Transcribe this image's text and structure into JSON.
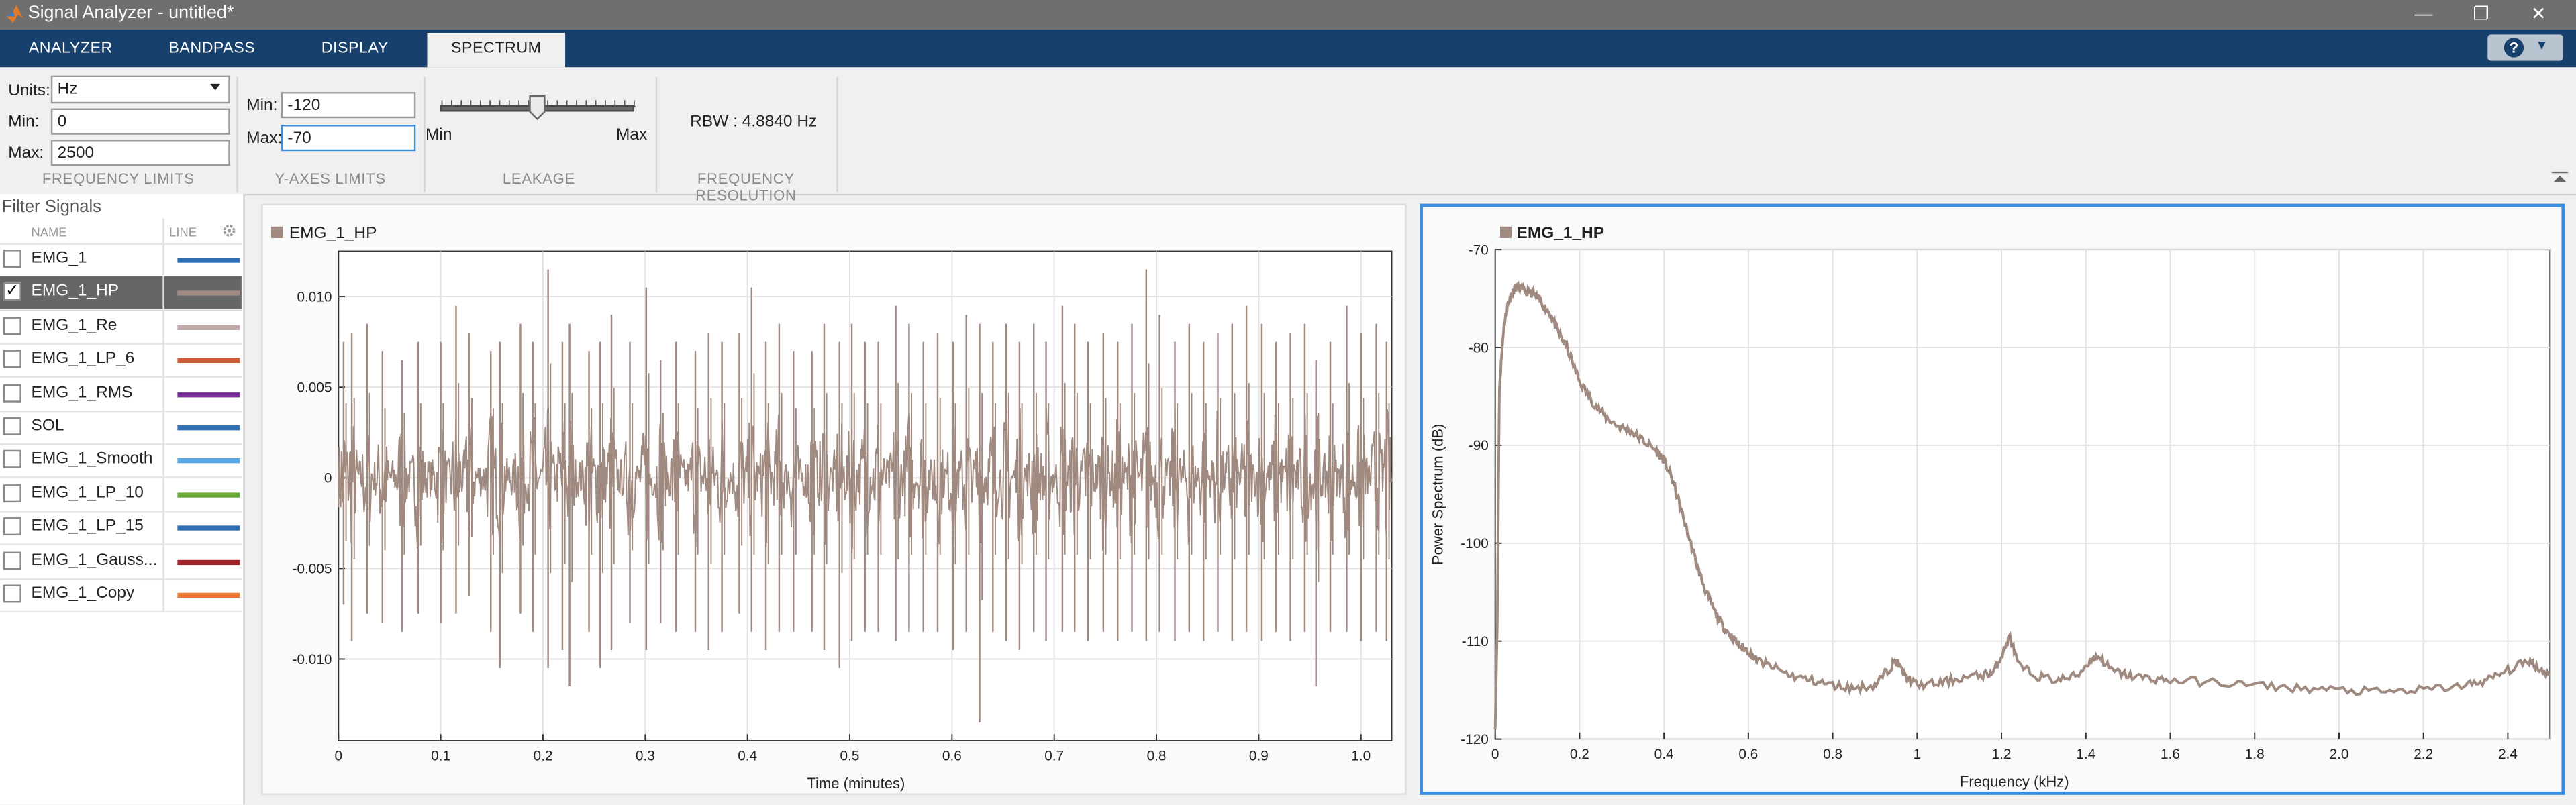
{
  "window": {
    "title": "Signal Analyzer - untitled*",
    "controls": [
      "—",
      "❐",
      "✕"
    ]
  },
  "tabs": [
    {
      "label": "ANALYZER",
      "active": false
    },
    {
      "label": "BANDPASS",
      "active": false
    },
    {
      "label": "DISPLAY",
      "active": false
    },
    {
      "label": "SPECTRUM",
      "active": true
    }
  ],
  "help": {
    "icon": "help-icon",
    "dropdown": "▼"
  },
  "frequency_limits": {
    "units_label": "Units:",
    "units_value": "Hz",
    "min_label": "Min:",
    "min_value": "0",
    "max_label": "Max:",
    "max_value": "2500",
    "section_title": "FREQUENCY LIMITS"
  },
  "y_axes_limits": {
    "min_label": "Min:",
    "min_value": "-120",
    "max_label": "Max:",
    "max_value": "-70",
    "section_title": "Y-AXES LIMITS"
  },
  "leakage": {
    "min_label": "Min",
    "max_label": "Max",
    "value": 0.5,
    "section_title": "LEAKAGE"
  },
  "frequency_resolution": {
    "rbw_text": "RBW : 4.8840 Hz",
    "section_title": "FREQUENCY RESOLUTION"
  },
  "filter_panel": {
    "title": "Filter Signals",
    "col_name": "NAME",
    "col_line": "LINE",
    "signals": [
      {
        "name": "EMG_1",
        "checked": false,
        "color": "#2f6fb5"
      },
      {
        "name": "EMG_1_HP",
        "checked": true,
        "color": "#a08a80",
        "selected": true
      },
      {
        "name": "EMG_1_Re",
        "checked": false,
        "color": "#c0aaa8"
      },
      {
        "name": "EMG_1_LP_6",
        "checked": false,
        "color": "#cf5a35"
      },
      {
        "name": "EMG_1_RMS",
        "checked": false,
        "color": "#7b2f9c"
      },
      {
        "name": "SOL",
        "checked": false,
        "color": "#2f6fb5"
      },
      {
        "name": "EMG_1_Smooth",
        "checked": false,
        "color": "#55a7e6"
      },
      {
        "name": "EMG_1_LP_10",
        "checked": false,
        "color": "#6aaa3a"
      },
      {
        "name": "EMG_1_LP_15",
        "checked": false,
        "color": "#2f6fb5"
      },
      {
        "name": "EMG_1_Gauss...",
        "checked": false,
        "color": "#a2232c"
      },
      {
        "name": "EMG_1_Copy",
        "checked": false,
        "color": "#e9772f"
      }
    ]
  },
  "colors": {
    "signal": "#a08a80",
    "accent": "#3b8ede",
    "tabbar": "#17406c"
  },
  "chart_data": [
    {
      "type": "line",
      "legend": "EMG_1_HP",
      "xlabel": "Time (minutes)",
      "ylabel": "",
      "xlim": [
        0,
        1.03
      ],
      "ylim": [
        -0.0145,
        0.0125
      ],
      "xticks": [
        "0",
        "0.1",
        "0.2",
        "0.3",
        "0.4",
        "0.5",
        "0.6",
        "0.7",
        "0.8",
        "0.9",
        "1.0"
      ],
      "xtick_values": [
        0,
        0.1,
        0.2,
        0.3,
        0.4,
        0.5,
        0.6,
        0.7,
        0.8,
        0.9,
        1.0
      ],
      "yticks": [
        "0.010",
        "0.005",
        "0",
        "-0.005",
        "-0.010"
      ],
      "ytick_values": [
        0.01,
        0.005,
        0,
        -0.005,
        -0.01
      ],
      "series": [
        {
          "name": "EMG_1_HP",
          "bursts": [
            [
              0.005,
              0.0075,
              -0.007
            ],
            [
              0.013,
              0.008,
              -0.009
            ],
            [
              0.028,
              0.0085,
              -0.0075
            ],
            [
              0.043,
              0.007,
              -0.008
            ],
            [
              0.062,
              0.0065,
              -0.0085
            ],
            [
              0.078,
              0.0075,
              -0.0075
            ],
            [
              0.1,
              0.0075,
              -0.008
            ],
            [
              0.115,
              0.0095,
              -0.0075
            ],
            [
              0.128,
              0.008,
              -0.0065
            ],
            [
              0.149,
              0.007,
              -0.0085
            ],
            [
              0.158,
              0.0075,
              -0.0105
            ],
            [
              0.178,
              0.0085,
              -0.0075
            ],
            [
              0.19,
              0.0075,
              -0.0085
            ],
            [
              0.205,
              0.0115,
              -0.0105
            ],
            [
              0.219,
              0.0075,
              -0.0095
            ],
            [
              0.226,
              0.0085,
              -0.0115
            ],
            [
              0.245,
              0.007,
              -0.0085
            ],
            [
              0.256,
              0.0075,
              -0.0105
            ],
            [
              0.267,
              0.009,
              -0.0095
            ],
            [
              0.285,
              0.0075,
              -0.008
            ],
            [
              0.301,
              0.0105,
              -0.0095
            ],
            [
              0.315,
              0.0065,
              -0.008
            ],
            [
              0.33,
              0.0075,
              -0.0085
            ],
            [
              0.349,
              0.007,
              -0.0085
            ],
            [
              0.362,
              0.008,
              -0.0095
            ],
            [
              0.375,
              0.0075,
              -0.0085
            ],
            [
              0.392,
              0.008,
              -0.0075
            ],
            [
              0.404,
              0.0105,
              -0.0085
            ],
            [
              0.418,
              0.0075,
              -0.0095
            ],
            [
              0.431,
              0.0085,
              -0.0085
            ],
            [
              0.445,
              0.007,
              -0.0085
            ],
            [
              0.463,
              0.007,
              -0.0085
            ],
            [
              0.475,
              0.0085,
              -0.0095
            ],
            [
              0.49,
              0.0075,
              -0.0105
            ],
            [
              0.502,
              0.0085,
              -0.009
            ],
            [
              0.515,
              0.0075,
              -0.0085
            ],
            [
              0.528,
              0.0075,
              -0.0085
            ],
            [
              0.545,
              0.0095,
              -0.009
            ],
            [
              0.558,
              0.0085,
              -0.0085
            ],
            [
              0.572,
              0.0075,
              -0.0085
            ],
            [
              0.586,
              0.008,
              -0.0085
            ],
            [
              0.601,
              0.0075,
              -0.0095
            ],
            [
              0.614,
              0.009,
              -0.0085
            ],
            [
              0.627,
              0.0085,
              -0.0135
            ],
            [
              0.64,
              0.0075,
              -0.0085
            ],
            [
              0.653,
              0.0085,
              -0.009
            ],
            [
              0.666,
              0.0075,
              -0.0095
            ],
            [
              0.68,
              0.0085,
              -0.0085
            ],
            [
              0.692,
              0.0075,
              -0.009
            ],
            [
              0.708,
              0.0095,
              -0.0085
            ],
            [
              0.72,
              0.0085,
              -0.0085
            ],
            [
              0.733,
              0.0075,
              -0.009
            ],
            [
              0.748,
              0.008,
              -0.0085
            ],
            [
              0.762,
              0.0075,
              -0.009
            ],
            [
              0.776,
              0.0085,
              -0.0085
            ],
            [
              0.79,
              0.0115,
              -0.009
            ],
            [
              0.803,
              0.009,
              -0.0085
            ],
            [
              0.818,
              0.0075,
              -0.009
            ],
            [
              0.832,
              0.0085,
              -0.0085
            ],
            [
              0.846,
              0.0075,
              -0.009
            ],
            [
              0.86,
              0.008,
              -0.0085
            ],
            [
              0.874,
              0.0085,
              -0.009
            ],
            [
              0.888,
              0.0095,
              -0.0085
            ],
            [
              0.903,
              0.0085,
              -0.009
            ],
            [
              0.917,
              0.0075,
              -0.0085
            ],
            [
              0.931,
              0.008,
              -0.009
            ],
            [
              0.945,
              0.0085,
              -0.0085
            ],
            [
              0.956,
              0.0065,
              -0.0115
            ],
            [
              0.97,
              0.0075,
              -0.0085
            ],
            [
              0.986,
              0.0095,
              -0.0085
            ],
            [
              1.0,
              0.008,
              -0.009
            ],
            [
              1.015,
              0.0085,
              -0.0085
            ],
            [
              1.025,
              0.0075,
              -0.009
            ]
          ]
        }
      ]
    },
    {
      "type": "line",
      "legend": "EMG_1_HP",
      "xlabel": "Frequency (kHz)",
      "ylabel": "Power Spectrum (dB)",
      "xlim": [
        0,
        2.5
      ],
      "ylim": [
        -120,
        -70
      ],
      "xticks": [
        "0",
        "0.2",
        "0.4",
        "0.6",
        "0.8",
        "1",
        "1.2",
        "1.4",
        "1.6",
        "1.8",
        "2.0",
        "2.2",
        "2.4"
      ],
      "xtick_values": [
        0,
        0.2,
        0.4,
        0.6,
        0.8,
        1.0,
        1.2,
        1.4,
        1.6,
        1.8,
        2.0,
        2.2,
        2.4
      ],
      "yticks": [
        "-70",
        "-80",
        "-90",
        "-100",
        "-110",
        "-120"
      ],
      "ytick_values": [
        -70,
        -80,
        -90,
        -100,
        -110,
        -120
      ],
      "series": [
        {
          "name": "EMG_1_HP",
          "x": [
            0,
            0.005,
            0.01,
            0.02,
            0.03,
            0.04,
            0.05,
            0.07,
            0.09,
            0.11,
            0.13,
            0.15,
            0.17,
            0.2,
            0.23,
            0.26,
            0.29,
            0.32,
            0.35,
            0.38,
            0.4,
            0.42,
            0.44,
            0.46,
            0.48,
            0.5,
            0.52,
            0.54,
            0.56,
            0.58,
            0.6,
            0.62,
            0.65,
            0.7,
            0.75,
            0.8,
            0.85,
            0.9,
            0.93,
            0.95,
            0.97,
            1.0,
            1.05,
            1.1,
            1.15,
            1.18,
            1.2,
            1.22,
            1.24,
            1.28,
            1.33,
            1.38,
            1.41,
            1.43,
            1.46,
            1.5,
            1.55,
            1.6,
            1.7,
            1.8,
            1.9,
            2.0,
            2.1,
            2.2,
            2.3,
            2.35,
            2.4,
            2.45,
            2.48,
            2.5
          ],
          "y": [
            -119,
            -108,
            -84,
            -78,
            -75.5,
            -74.5,
            -73.8,
            -74.2,
            -74.5,
            -75.5,
            -76.5,
            -78.5,
            -80,
            -83.5,
            -85.5,
            -87,
            -88,
            -88.5,
            -89.5,
            -90.5,
            -91.5,
            -93.5,
            -96.5,
            -99.5,
            -102.5,
            -105,
            -107,
            -108.5,
            -109.5,
            -110.5,
            -111,
            -112,
            -112.5,
            -113.5,
            -114,
            -114.5,
            -114.8,
            -114.5,
            -113,
            -112,
            -113.5,
            -114.5,
            -114.3,
            -113.8,
            -113.5,
            -113.2,
            -111.5,
            -109.5,
            -112.5,
            -113.5,
            -114,
            -113.5,
            -112,
            -111.5,
            -113,
            -113.5,
            -113.8,
            -114,
            -114.2,
            -114.5,
            -114.8,
            -115,
            -115.2,
            -115,
            -114.5,
            -114,
            -113,
            -112,
            -113,
            -113.5
          ]
        }
      ]
    }
  ]
}
